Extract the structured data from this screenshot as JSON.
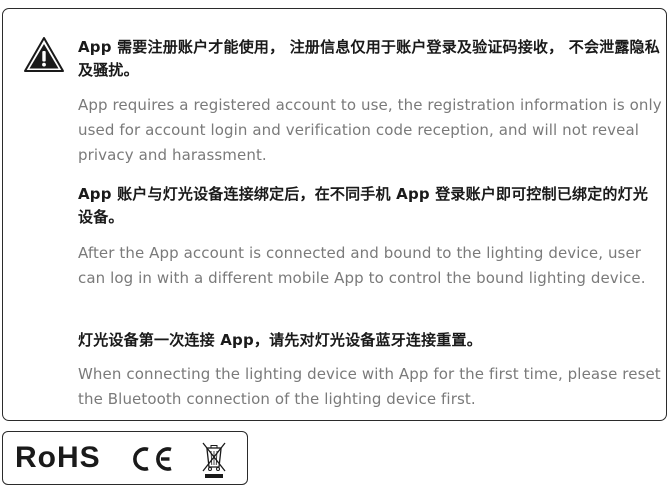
{
  "notice": {
    "cn1": "App 需要注册账户才能使用， 注册信息仅用于账户登录及验证码接收， 不会泄露隐私及骚扰。",
    "en1": "App requires a registered account to use, the registration information is only used for account login and verification code reception, and will not reveal privacy and harassment.",
    "cn2": "App 账户与灯光设备连接绑定后，在不同手机 App 登录账户即可控制已绑定的灯光设备。",
    "en2": "After the App account is connected and bound to the lighting device, user can log in with a different mobile App to control the bound lighting device.",
    "cn3": "灯光设备第一次连接 App，请先对灯光设备蓝牙连接重置。",
    "en3": "When connecting the lighting device with App for the first time, please reset the Bluetooth connection of the lighting device first."
  },
  "certifications": {
    "rohs": "RoHS",
    "icons": [
      "ce-mark-icon",
      "weee-crossed-bin-icon"
    ]
  },
  "icons": {
    "warning": "warning-triangle-icon"
  }
}
